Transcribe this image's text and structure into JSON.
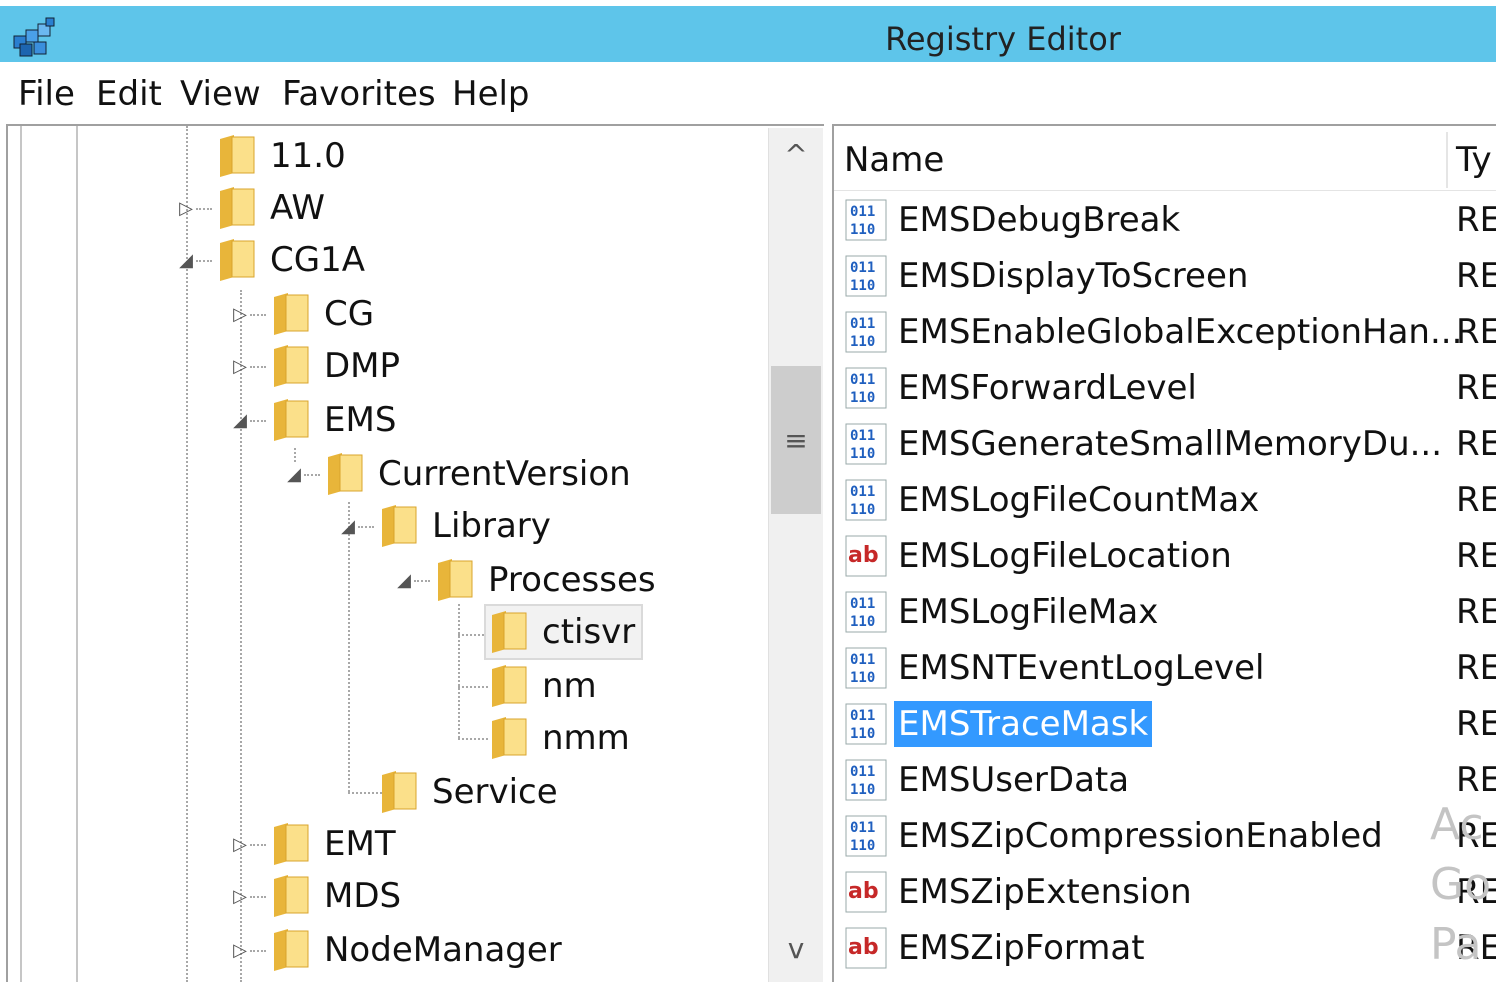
{
  "window": {
    "title": "Registry Editor"
  },
  "menu": [
    "File",
    "Edit",
    "View",
    "Favorites",
    "Help"
  ],
  "tree": {
    "nodes": [
      {
        "label": "11.0",
        "expander": ""
      },
      {
        "label": "AW",
        "expander": "▷"
      },
      {
        "label": "CG1A",
        "expander": "◢"
      },
      {
        "label": "CG",
        "expander": "▷"
      },
      {
        "label": "DMP",
        "expander": "▷"
      },
      {
        "label": "EMS",
        "expander": "◢"
      },
      {
        "label": "CurrentVersion",
        "expander": "◢"
      },
      {
        "label": "Library",
        "expander": "◢"
      },
      {
        "label": "Processes",
        "expander": "◢"
      },
      {
        "label": "ctisvr",
        "expander": "",
        "selected": true
      },
      {
        "label": "nm",
        "expander": ""
      },
      {
        "label": "nmm",
        "expander": ""
      },
      {
        "label": "Service",
        "expander": ""
      },
      {
        "label": "EMT",
        "expander": "▷"
      },
      {
        "label": "MDS",
        "expander": "▷"
      },
      {
        "label": "NodeManager",
        "expander": "▷"
      }
    ],
    "scroll": {
      "up": "^",
      "thumb": "≡",
      "down": "v"
    }
  },
  "list": {
    "columns": {
      "name": "Name",
      "type": "Ty"
    },
    "rows": [
      {
        "name": "EMSDebugBreak",
        "icon": "dword-icon",
        "type": "RE"
      },
      {
        "name": "EMSDisplayToScreen",
        "icon": "dword-icon",
        "type": "RE"
      },
      {
        "name": "EMSEnableGlobalExceptionHan...",
        "icon": "dword-icon",
        "type": "RE"
      },
      {
        "name": "EMSForwardLevel",
        "icon": "dword-icon",
        "type": "RE"
      },
      {
        "name": "EMSGenerateSmallMemoryDu...",
        "icon": "dword-icon",
        "type": "RE"
      },
      {
        "name": "EMSLogFileCountMax",
        "icon": "dword-icon",
        "type": "RE"
      },
      {
        "name": "EMSLogFileLocation",
        "icon": "string-icon",
        "type": "RE"
      },
      {
        "name": "EMSLogFileMax",
        "icon": "dword-icon",
        "type": "RE"
      },
      {
        "name": "EMSNTEventLogLevel",
        "icon": "dword-icon",
        "type": "RE"
      },
      {
        "name": "EMSTraceMask",
        "icon": "dword-icon",
        "type": "RE",
        "selected": true
      },
      {
        "name": "EMSUserData",
        "icon": "dword-icon",
        "type": "RE"
      },
      {
        "name": "EMSZipCompressionEnabled",
        "icon": "dword-icon",
        "type": "RE"
      },
      {
        "name": "EMSZipExtension",
        "icon": "string-icon",
        "type": "RE"
      },
      {
        "name": "EMSZipFormat",
        "icon": "string-icon",
        "type": "RE"
      }
    ]
  },
  "watermark": [
    "Ac",
    "Go",
    "Pa"
  ],
  "colors": {
    "titlebar": "#5ec5ea",
    "selection": "#3399ff"
  }
}
